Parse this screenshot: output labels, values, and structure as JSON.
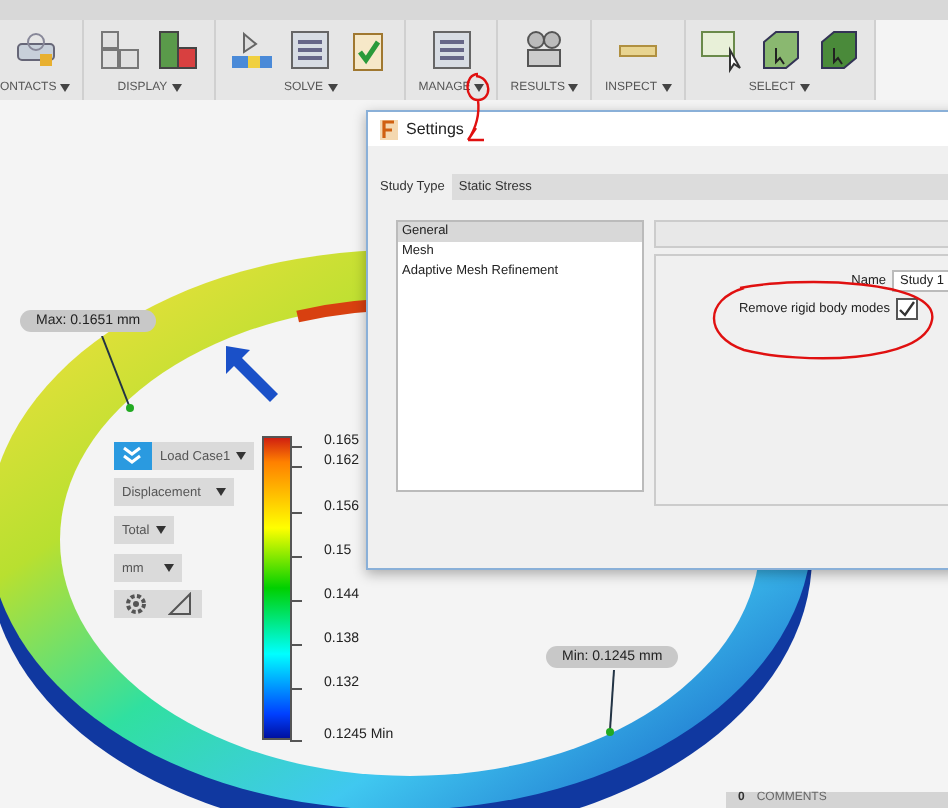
{
  "toolbar": {
    "groups": [
      {
        "label": "ONTACTS",
        "icons": [
          {
            "kind": "contacts"
          }
        ]
      },
      {
        "label": "DISPLAY",
        "icons": [
          {
            "kind": "blocks"
          },
          {
            "kind": "blocks-green"
          }
        ]
      },
      {
        "label": "SOLVE",
        "icons": [
          {
            "kind": "mesh"
          },
          {
            "kind": "form"
          },
          {
            "kind": "check"
          }
        ]
      },
      {
        "label": "MANAGE",
        "icons": [
          {
            "kind": "form"
          }
        ]
      },
      {
        "label": "RESULTS",
        "icons": [
          {
            "kind": "camera"
          }
        ]
      },
      {
        "label": "INSPECT",
        "icons": [
          {
            "kind": "ruler"
          }
        ]
      },
      {
        "label": "SELECT",
        "icons": [
          {
            "kind": "select-box"
          },
          {
            "kind": "cube"
          },
          {
            "kind": "cube-green"
          }
        ]
      }
    ]
  },
  "viewport": {
    "max_label": "Max: 0.1651 mm",
    "min_label": "Min: 0.1245 mm",
    "controls": {
      "load_case": "Load Case1",
      "result_type": "Displacement",
      "component": "Total",
      "unit": "mm"
    },
    "legend": [
      "0.165",
      "0.162",
      "0.156",
      "0.15",
      "0.144",
      "0.138",
      "0.132",
      "0.1245 Min"
    ]
  },
  "dialog": {
    "title": "Settings",
    "study_type_label": "Study Type",
    "study_type": "Static Stress",
    "items": [
      {
        "label": "General",
        "selected": true
      },
      {
        "label": "Mesh",
        "selected": false
      },
      {
        "label": "Adaptive Mesh Refinement",
        "selected": false
      }
    ],
    "name_label": "Name",
    "name_value": "Study 1",
    "remove_rigid": {
      "label": "Remove rigid body modes",
      "checked": true
    }
  },
  "comments": {
    "count": "0",
    "label": "COMMENTS"
  }
}
